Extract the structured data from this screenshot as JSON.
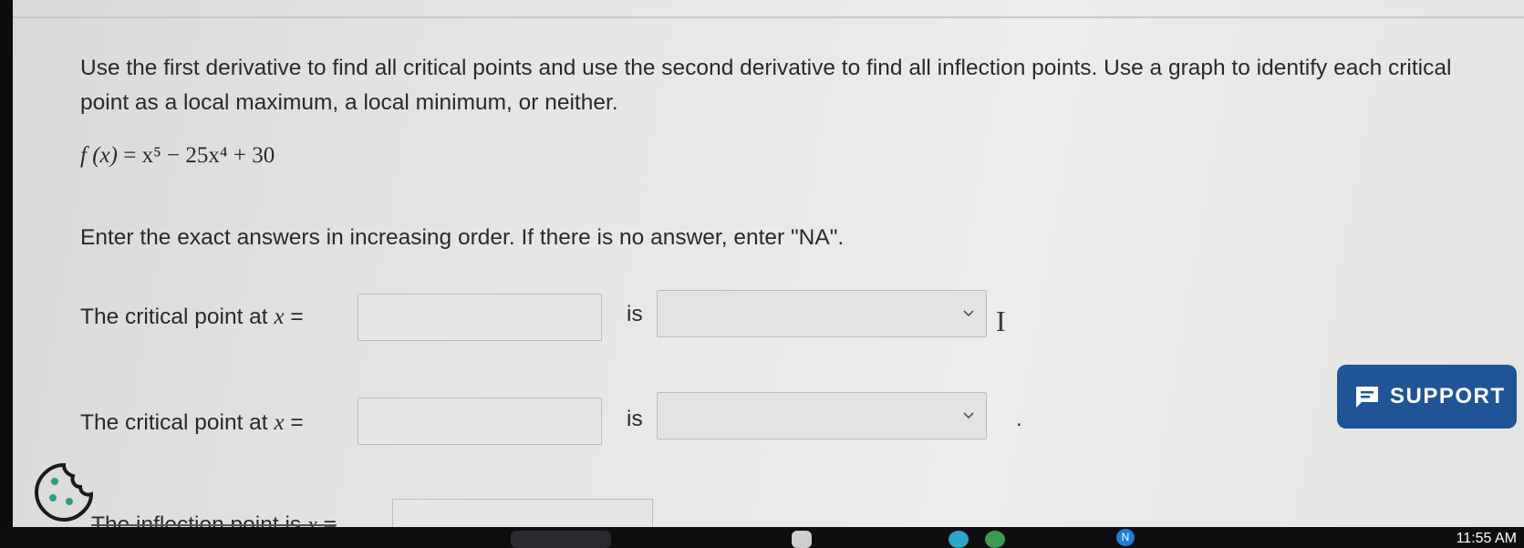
{
  "question": {
    "text": "Use the first derivative to find all critical points and use the second derivative to find all inflection points. Use a graph to identify each critical point as a local maximum, a local minimum, or neither.",
    "function_name": "f (x)",
    "formula": "x⁵ − 25x⁴ + 30"
  },
  "instruction": "Enter the exact answers in increasing order. If there is no answer, enter \"NA\".",
  "rows": [
    {
      "label": "The critical point at ",
      "variable": "x",
      "equals": " =",
      "is_label": "is",
      "input_value": "",
      "select_value": ""
    },
    {
      "label": "The critical point at ",
      "variable": "x",
      "equals": " =",
      "is_label": "is",
      "input_value": "",
      "select_value": ""
    }
  ],
  "inflection": {
    "label": "The inflection point is ",
    "variable": "x",
    "equals": " =",
    "input_value": ""
  },
  "support": {
    "label": "SUPPORT",
    "icon": "chat-icon",
    "color": "#1f5596"
  },
  "cookie": {
    "icon": "cookie-icon"
  },
  "taskbar": {
    "clock": "11:55 AM",
    "badge": "N"
  },
  "period": "."
}
